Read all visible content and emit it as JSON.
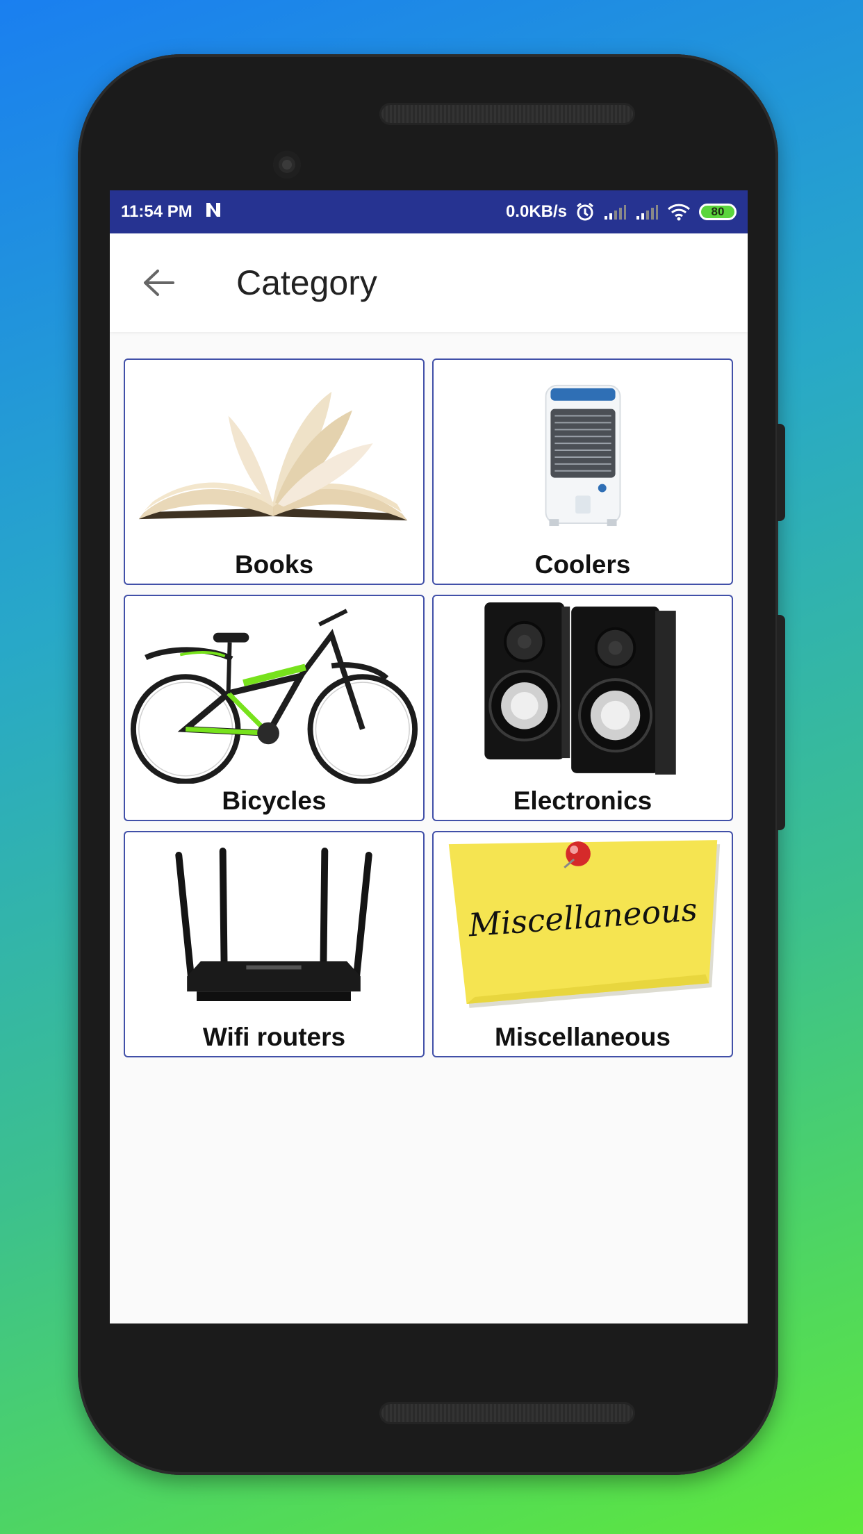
{
  "status_bar": {
    "time": "11:54 PM",
    "notification_icon": "n-icon",
    "network_speed": "0.0KB/s",
    "battery_level": "80"
  },
  "app_bar": {
    "back_icon": "arrow-left-icon",
    "title": "Category"
  },
  "categories": [
    {
      "label": "Books",
      "image": "open-book-image"
    },
    {
      "label": "Coolers",
      "image": "air-cooler-image"
    },
    {
      "label": "Bicycles",
      "image": "bicycle-image"
    },
    {
      "label": "Electronics",
      "image": "speakers-image"
    },
    {
      "label": "Wifi routers",
      "image": "wifi-router-image"
    },
    {
      "label": "Miscellaneous",
      "image": "sticky-note-image",
      "image_text": "Miscellaneous"
    }
  ],
  "colors": {
    "status_bar": "#263391",
    "card_border": "#4150a8",
    "battery_fill": "#5bd53d"
  }
}
